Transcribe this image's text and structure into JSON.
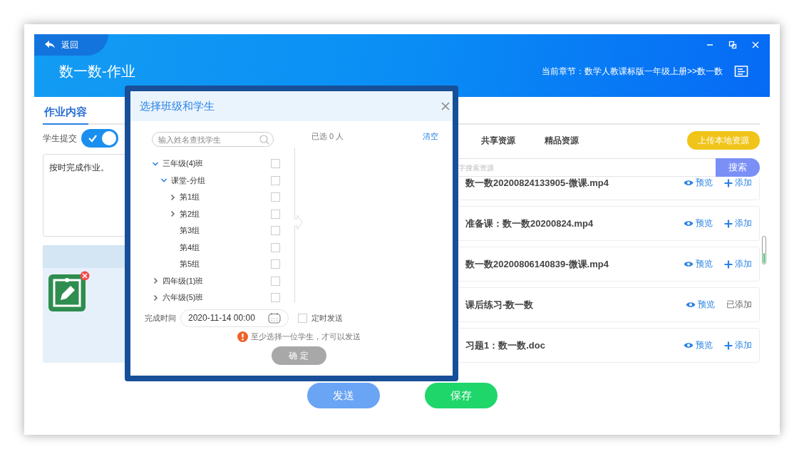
{
  "header": {
    "back": "返回",
    "title": "数一数-作业",
    "chapter": "当前章节：数学人教课标版一年级上册>>数一数"
  },
  "left": {
    "tab": "作业内容",
    "submit_label": "学生提交",
    "submit_on": true,
    "content": "按时完成作业。"
  },
  "right": {
    "tabs": [
      {
        "label": "共享资源",
        "selected": false
      },
      {
        "label": "精品资源",
        "selected": false
      }
    ],
    "upload": "上传本地资源",
    "search_placeholder": "字搜索资源",
    "search_button": "搜索",
    "resources": [
      {
        "name": "数一数20200824133905-微课.mp4",
        "preview": "预览",
        "add": "添加",
        "added": false
      },
      {
        "name": "准备课：数一数20200824.mp4",
        "preview": "预览",
        "add": "添加",
        "added": false
      },
      {
        "name": "数一数20200806140839-微课.mp4",
        "preview": "预览",
        "add": "添加",
        "added": false
      },
      {
        "name": "课后练习-数一数",
        "preview": "预览",
        "add": "已添加",
        "added": true
      },
      {
        "name": "习题1：数一数.doc",
        "preview": "预览",
        "add": "添加",
        "added": false
      }
    ]
  },
  "buttons": [
    {
      "label": "发送",
      "kind": "send"
    },
    {
      "label": "保存",
      "kind": "save"
    }
  ],
  "dialog": {
    "title": "选择班级和学生",
    "search_placeholder": "输入姓名查找学生",
    "selected_count": "已选 0 人",
    "clear": "清空",
    "tree": [
      {
        "label": "三年级(4)班",
        "expanded": true,
        "checked": false,
        "children": [
          {
            "label": "课堂-分组",
            "expanded": true,
            "checked": false,
            "children": [
              {
                "label": "第1组",
                "expanded": false,
                "checked": false
              },
              {
                "label": "第2组",
                "expanded": false,
                "checked": false
              },
              {
                "label": "第3组",
                "checked": false
              },
              {
                "label": "第4组",
                "checked": false
              },
              {
                "label": "第5组",
                "checked": false
              }
            ]
          }
        ]
      },
      {
        "label": "四年级(1)班",
        "expanded": false,
        "checked": false
      },
      {
        "label": "六年级(5)班",
        "expanded": false,
        "checked": false
      }
    ],
    "time_label": "完成时间",
    "time_value": "2020-11-14 00:00",
    "scheduled_label": "定时发送",
    "scheduled": false,
    "warning": "至少选择一位学生，才可以发送",
    "confirm": "确 定",
    "confirm_disabled": true
  }
}
